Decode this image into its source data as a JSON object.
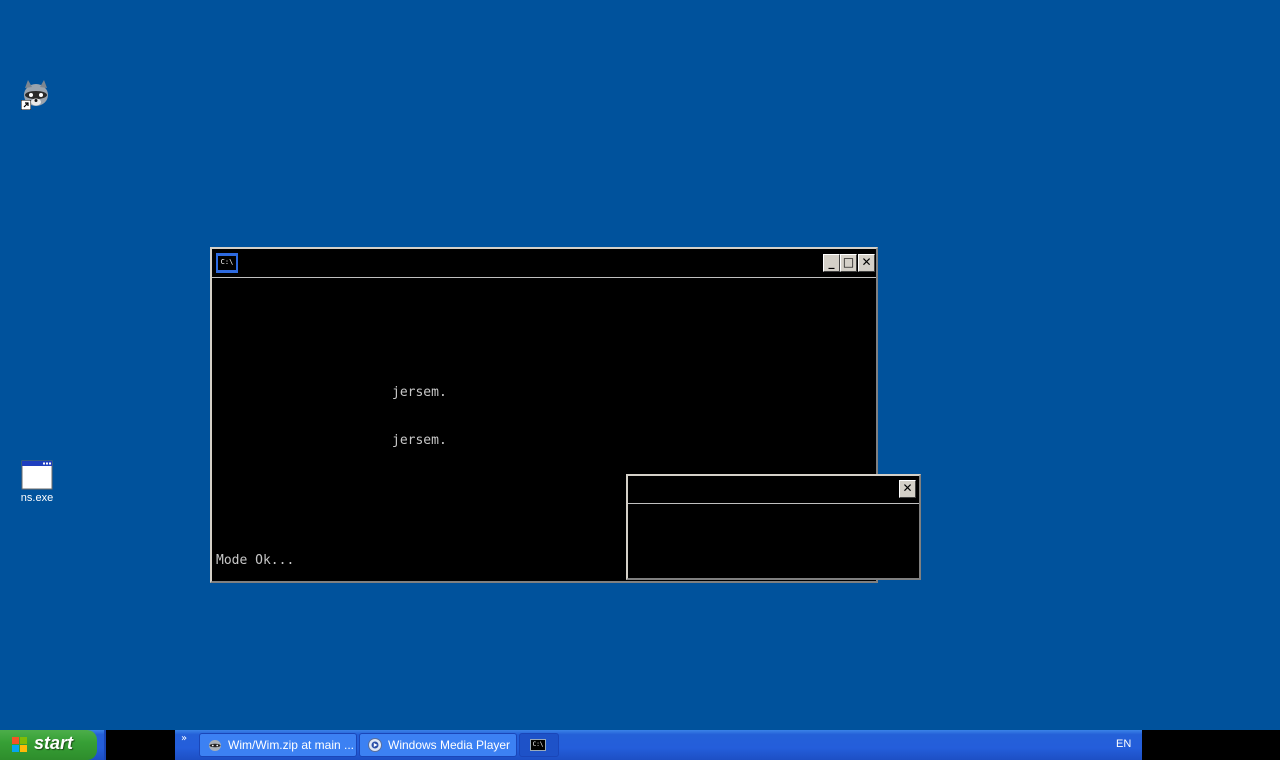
{
  "desktop": {
    "background_color": "#00529c",
    "icons": [
      {
        "name": "raccoon-shortcut",
        "label": "",
        "icon": "raccoon-icon"
      },
      {
        "name": "ns-exe",
        "label": "ns.exe",
        "icon": "application-window-icon"
      }
    ]
  },
  "console": {
    "icon_text": "C:\\",
    "buttons": {
      "minimize": "_",
      "maximize": "□",
      "close": "✕"
    },
    "lines": [
      "jersem.",
      "jersem.",
      "Mode Ok..."
    ]
  },
  "popup": {
    "close": "✕"
  },
  "taskbar": {
    "start_label": "start",
    "chevron": "»",
    "tasks": [
      {
        "label": "Wim/Wim.zip at main ...",
        "icon": "raccoon-icon"
      },
      {
        "label": "Windows Media Player",
        "icon": "media-player-icon"
      },
      {
        "label": "",
        "icon": "cmd-icon",
        "icon_text": "C:\\"
      }
    ],
    "language": "EN"
  }
}
